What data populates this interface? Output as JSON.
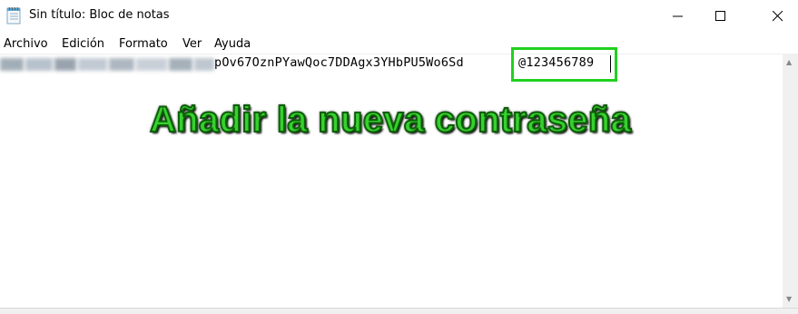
{
  "window": {
    "title": "Sin título: Bloc de notas"
  },
  "menu": {
    "items": [
      "Archivo",
      "Edición",
      "Formato",
      "Ver",
      "Ayuda"
    ]
  },
  "editor": {
    "visible_line": "pOv67OznPYawQoc7DDAgx3YHbPU5Wo6Sd",
    "new_password": "@123456789"
  },
  "annotation": {
    "text": "Añadir la nueva contraseña"
  },
  "colors": {
    "highlight": "#21d01e"
  },
  "icons": [
    "notepad-icon",
    "minimize-icon",
    "maximize-icon",
    "close-icon"
  ]
}
